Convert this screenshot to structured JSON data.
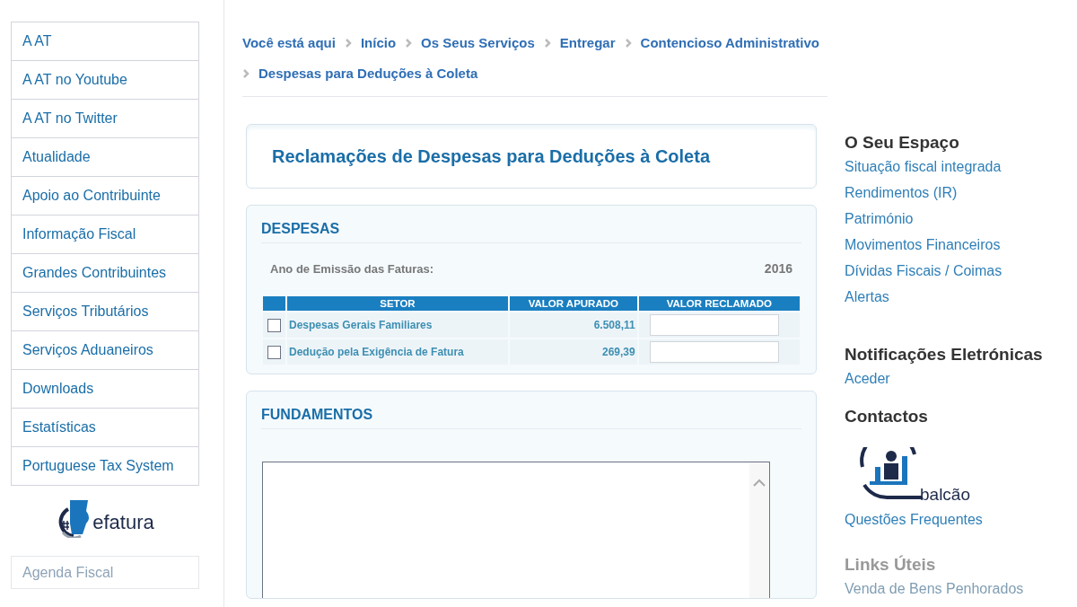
{
  "sidebar": {
    "items": [
      {
        "label": "A AT"
      },
      {
        "label": "A AT no Youtube"
      },
      {
        "label": "A AT no Twitter"
      },
      {
        "label": "Atualidade"
      },
      {
        "label": "Apoio ao Contribuinte"
      },
      {
        "label": "Informação Fiscal"
      },
      {
        "label": "Grandes Contribuintes"
      },
      {
        "label": "Serviços Tributários"
      },
      {
        "label": "Serviços Aduaneiros"
      },
      {
        "label": "Downloads"
      },
      {
        "label": "Estatísticas"
      },
      {
        "label": "Portuguese Tax System"
      }
    ],
    "logo_text": "efatura",
    "agenda_button": "Agenda Fiscal"
  },
  "breadcrumb": {
    "label": "Você está aqui",
    "items": [
      "Início",
      "Os Seus Serviços",
      "Entregar",
      "Contencioso Administrativo",
      "Despesas para Deduções à Coleta"
    ]
  },
  "page_title": "Reclamações de Despesas para Deduções à Coleta",
  "despesas": {
    "heading": "DESPESAS",
    "year_label": "Ano de Emissão das Faturas:",
    "year": "2016",
    "columns": [
      "SETOR",
      "VALOR APURADO",
      "VALOR RECLAMADO"
    ],
    "rows": [
      {
        "checked": false,
        "setor": "Despesas Gerais Familiares",
        "valor_apurado": "6.508,11"
      },
      {
        "checked": false,
        "setor": "Dedução pela Exigência de Fatura",
        "valor_apurado": "269,39"
      }
    ]
  },
  "fundamentos": {
    "heading": "FUNDAMENTOS"
  },
  "right": {
    "sections": [
      {
        "kind": "links",
        "heading": "O Seu Espaço",
        "links": [
          "Situação fiscal integrada",
          "Rendimentos (IR)",
          "Património",
          "Movimentos Financeiros",
          "Dívidas Fiscais / Coimas",
          "Alertas"
        ]
      },
      {
        "kind": "links",
        "heading": "Notificações Eletrónicas",
        "links": [
          "Aceder"
        ]
      },
      {
        "kind": "contact",
        "heading": "Contactos",
        "logo_text": "balcão",
        "links": [
          "Questões Frequentes"
        ]
      },
      {
        "kind": "faded",
        "heading": "Links Úteis",
        "links": [
          "Venda de Bens Penhorados"
        ]
      }
    ]
  }
}
